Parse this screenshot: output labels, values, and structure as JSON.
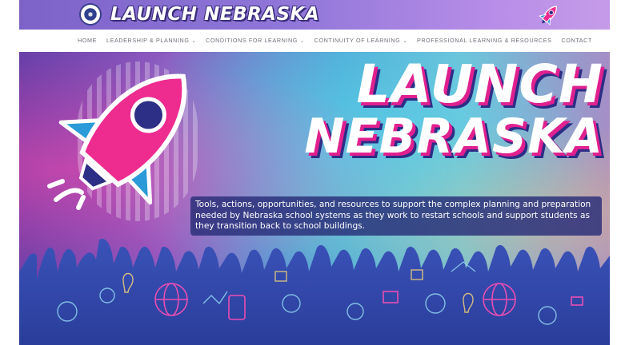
{
  "header": {
    "brand_title": "LAUNCH NEBRASKA",
    "seal_icon": "state-seal",
    "rocket_icon": "rocket-icon"
  },
  "nav": {
    "items": [
      {
        "label": "HOME",
        "has_dropdown": false
      },
      {
        "label": "LEADERSHIP & PLANNING",
        "has_dropdown": true
      },
      {
        "label": "CONDITIONS FOR LEARNING",
        "has_dropdown": true
      },
      {
        "label": "CONTINUITY OF LEARNING",
        "has_dropdown": true
      },
      {
        "label": "PROFESSIONAL LEARNING & RESOURCES",
        "has_dropdown": false
      },
      {
        "label": "CONTACT",
        "has_dropdown": false
      }
    ],
    "dropdown_glyph": "⌄"
  },
  "hero": {
    "title_line1": "LAUNCH",
    "title_line2": "NEBRASKA",
    "description": "Tools, actions, opportunities, and resources to support the complex planning and preparation needed by Nebraska school systems as they work to restart schools and support students as they transition back to school buildings."
  },
  "colors": {
    "banner": "#8f76d8",
    "accent_pink": "#e0208f",
    "navy": "#2d2e86",
    "nav_text": "#6e6e7a"
  }
}
